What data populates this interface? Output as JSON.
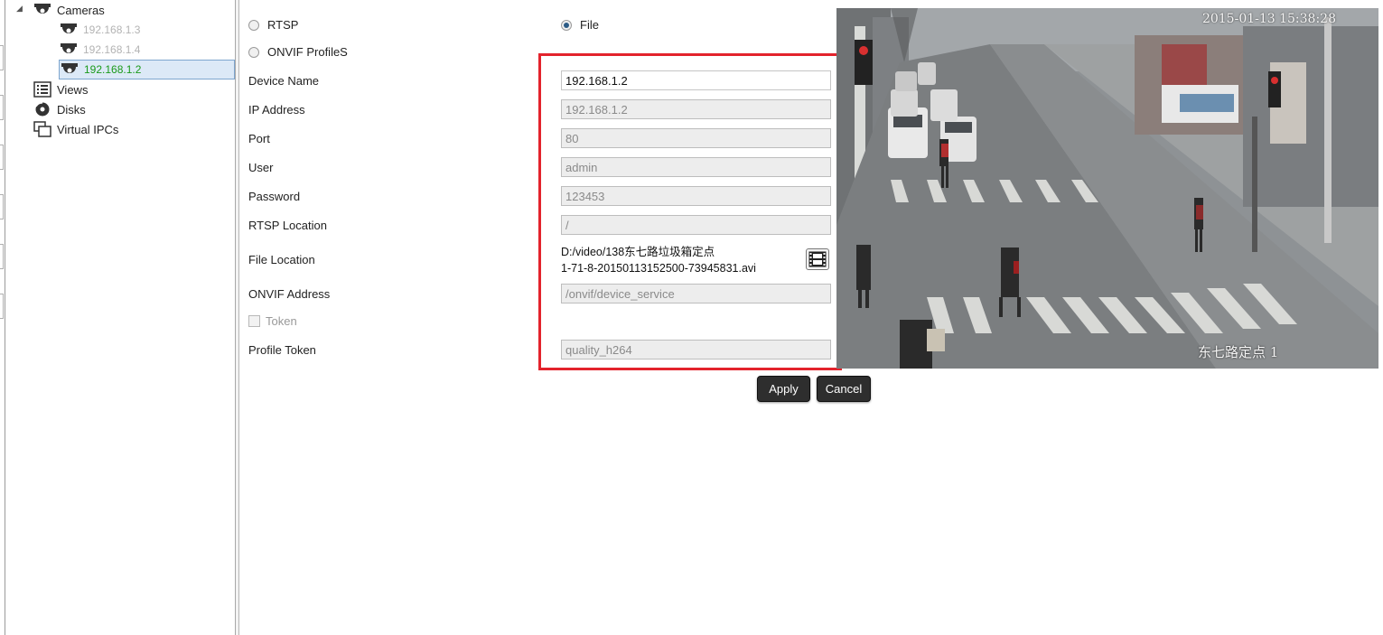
{
  "sidebar": {
    "root_label": "Cameras",
    "cameras": [
      {
        "label": "192.168.1.3"
      },
      {
        "label": "192.168.1.4"
      },
      {
        "label": "192.168.1.2"
      }
    ],
    "views_label": "Views",
    "disks_label": "Disks",
    "virtual_ipcs_label": "Virtual IPCs"
  },
  "source": {
    "rtsp_label": "RTSP",
    "file_label": "File",
    "onvif_label": "ONVIF ProfileS",
    "selected": "File"
  },
  "form": {
    "device_name": {
      "label": "Device Name",
      "value": "192.168.1.2"
    },
    "ip_address": {
      "label": "IP Address",
      "value": "192.168.1.2"
    },
    "port": {
      "label": "Port",
      "value": "80"
    },
    "user": {
      "label": "User",
      "value": "admin"
    },
    "password": {
      "label": "Password",
      "value": "123453"
    },
    "rtsp_location": {
      "label": "RTSP Location",
      "value": "/"
    },
    "file_location": {
      "label": "File Location",
      "line1": "D:/video/138东七路垃圾箱定点",
      "line2": "1-71-8-20150113152500-73945831.avi"
    },
    "onvif_address": {
      "label": "ONVIF Address",
      "value": "/onvif/device_service"
    },
    "token": {
      "label": "Token",
      "checked": false
    },
    "profile_token": {
      "label": "Profile Token",
      "value": "quality_h264"
    }
  },
  "buttons": {
    "apply": "Apply",
    "cancel": "Cancel"
  },
  "preview": {
    "timestamp": "2015-01-13 15:38:28",
    "location": "东七路定点 1"
  },
  "colors": {
    "highlight": "#e3232c",
    "selected_camera_text": "#1a9a1a"
  }
}
